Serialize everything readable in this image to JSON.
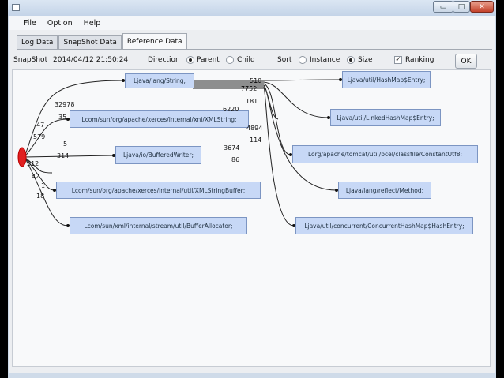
{
  "window": {
    "icon": "app-icon",
    "minimize_label": "▭",
    "maximize_label": "□",
    "close_label": "✕"
  },
  "menu": [
    "File",
    "Option",
    "Help"
  ],
  "tabs": [
    {
      "label": "Log Data",
      "active": false
    },
    {
      "label": "SnapShot Data",
      "active": false
    },
    {
      "label": "Reference Data",
      "active": true
    }
  ],
  "toolbar": {
    "snapshot_label": "SnapShot",
    "snapshot_value": "2014/04/12 21:50:24",
    "direction_label": "Direction",
    "parent_label": "Parent",
    "child_label": "Child",
    "direction_selected": "Parent",
    "sort_label": "Sort",
    "instance_label": "Instance",
    "size_label": "Size",
    "sort_selected": "Size",
    "ranking_label": "Ranking",
    "ranking_checked": true,
    "ok_label": "OK"
  },
  "graph": {
    "center_color": "#e02020",
    "center_nodes": [
      "Ljava/lang/String;",
      "Lcom/sun/org/apache/xerces/internal/xni/XMLString;",
      "Ljava/io/BufferedWriter;",
      "Lcom/sun/org/apache/xerces/internal/util/XMLStringBuffer;",
      "Lcom/sun/xml/internal/stream/util/BufferAllocator;"
    ],
    "right_nodes": [
      "Ljava/util/HashMap$Entry;",
      "Ljava/util/LinkedHashMap$Entry;",
      "Lorg/apache/tomcat/util/bcel/classfile/ConstantUtf8;",
      "Ljava/lang/reflect/Method;",
      "Ljava/util/concurrent/ConcurrentHashMap$HashEntry;"
    ],
    "left_numbers": [
      "32978",
      "35",
      "47",
      "579",
      "5",
      "314",
      "312",
      "42",
      "1",
      "18"
    ],
    "right_numbers": [
      "510",
      "7752",
      "181",
      "6220",
      "4894",
      "114",
      "3674",
      "86"
    ]
  }
}
